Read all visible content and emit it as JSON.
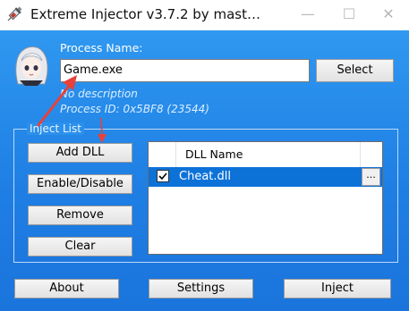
{
  "window": {
    "title": "Extreme Injector v3.7.2 by mast…",
    "minimize_glyph": "—",
    "maximize_glyph": "☐",
    "close_glyph": "✕"
  },
  "process": {
    "label": "Process Name:",
    "value": "Game.exe",
    "select_label": "Select",
    "description": "No description",
    "pid": "Process ID: 0x5BF8 (23544)"
  },
  "inject_list": {
    "legend": "Inject List",
    "buttons": {
      "add": "Add DLL",
      "enable": "Enable/Disable",
      "remove": "Remove",
      "clear": "Clear"
    },
    "columns": [
      "DLL Name"
    ],
    "items": [
      {
        "name": "Cheat.dll",
        "checked": true,
        "selected": true,
        "action": "..."
      }
    ]
  },
  "bottom_buttons": {
    "about": "About",
    "settings": "Settings",
    "inject": "Inject"
  },
  "colors": {
    "client_bg": "#1f7fe4",
    "row_selected": "#0d72d8",
    "annotation_arrow": "#e8413a"
  },
  "icons": [
    "syringe-icon",
    "anime-avatar-icon",
    "checkbox-checked-icon"
  ]
}
